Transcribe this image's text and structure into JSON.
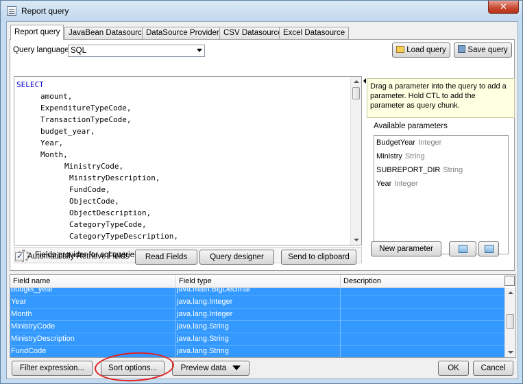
{
  "window": {
    "title": "Report query",
    "close_label": "✕"
  },
  "tabs": [
    {
      "label": "Report query",
      "active": true
    },
    {
      "label": "JavaBean Datasource"
    },
    {
      "label": "DataSource Provider"
    },
    {
      "label": "CSV Datasource"
    },
    {
      "label": "Excel Datasource"
    }
  ],
  "query": {
    "language_label": "Query language",
    "language_value": "SQL",
    "load_label": "Load query",
    "save_label": "Save query",
    "lines": [
      {
        "indent": 0,
        "text": "SELECT",
        "kw": true
      },
      {
        "indent": 5,
        "text": "amount,"
      },
      {
        "indent": 5,
        "text": "ExpenditureTypeCode,"
      },
      {
        "indent": 5,
        "text": "TransactionTypeCode,"
      },
      {
        "indent": 5,
        "text": "budget_year,"
      },
      {
        "indent": 5,
        "text": "Year,"
      },
      {
        "indent": 5,
        "text": "Month,"
      },
      {
        "indent": 10,
        "text": "MinistryCode,"
      },
      {
        "indent": 11,
        "text": "MinistryDescription,"
      },
      {
        "indent": 11,
        "text": "FundCode,"
      },
      {
        "indent": 11,
        "text": "ObjectCode,"
      },
      {
        "indent": 11,
        "text": "ObjectDescription,"
      },
      {
        "indent": 11,
        "text": "CategoryTypeCode,"
      },
      {
        "indent": 11,
        "text": "CategoryTypeDescription,"
      }
    ],
    "status_text": "Fields provider for sql queries ready.",
    "auto_retrieve_label": "Automatically Retrieve Fields",
    "read_fields_label": "Read Fields",
    "designer_label": "Query designer",
    "clipboard_label": "Send to clipboard"
  },
  "params": {
    "hint": "Drag a parameter into the query to add a parameter. Hold CTL to add the parameter as query chunk.",
    "available_label": "Available parameters",
    "items": [
      {
        "name": "BudgetYear",
        "type": "Integer"
      },
      {
        "name": "Ministry",
        "type": "String"
      },
      {
        "name": "SUBREPORT_DIR",
        "type": "String"
      },
      {
        "name": "Year",
        "type": "Integer"
      }
    ],
    "new_label": "New parameter"
  },
  "fields": {
    "headers": [
      "Field name",
      "Field type",
      "Description"
    ],
    "rows": [
      {
        "name": "budget_year",
        "type": "java.math.BigDecimal",
        "desc": ""
      },
      {
        "name": "Year",
        "type": "java.lang.Integer",
        "desc": ""
      },
      {
        "name": "Month",
        "type": "java.lang.Integer",
        "desc": ""
      },
      {
        "name": "MinistryCode",
        "type": "java.lang.String",
        "desc": ""
      },
      {
        "name": "MinistryDescription",
        "type": "java.lang.String",
        "desc": ""
      },
      {
        "name": "FundCode",
        "type": "java.lang.String",
        "desc": ""
      }
    ]
  },
  "footer": {
    "filter_label": "Filter expression...",
    "sort_label": "Sort options...",
    "preview_label": "Preview data",
    "ok_label": "OK",
    "cancel_label": "Cancel"
  },
  "colors": {
    "selection": "#3399ff",
    "annotation": "#e02020"
  }
}
